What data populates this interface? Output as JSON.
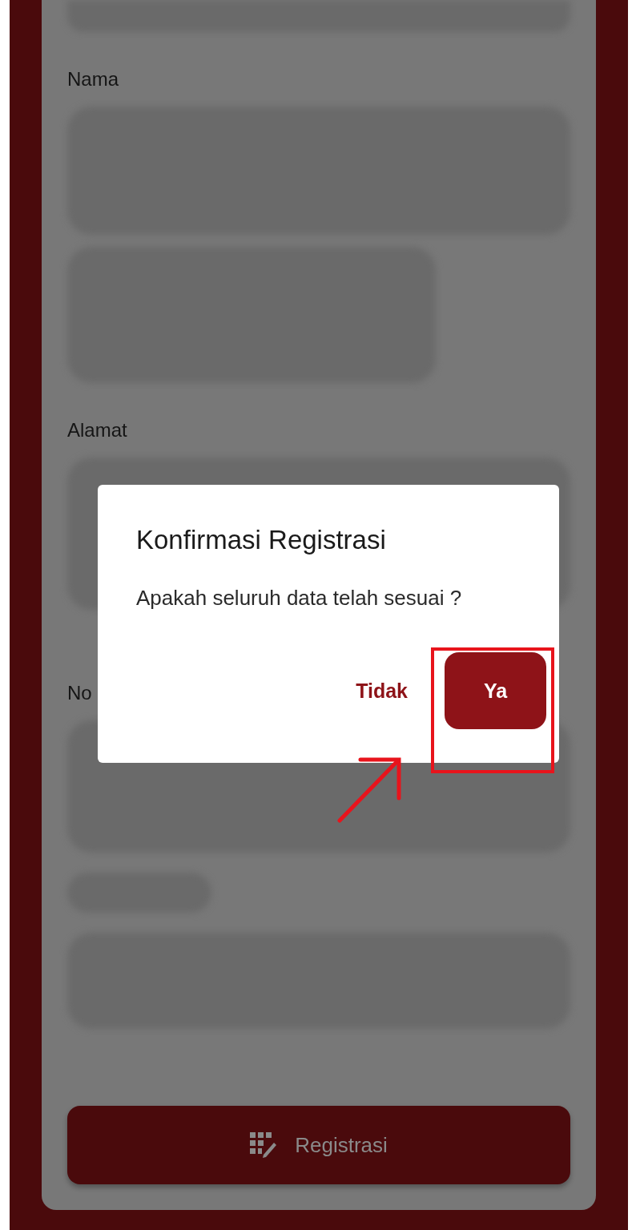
{
  "form": {
    "fields": [
      {
        "label": "Nama"
      },
      {
        "label": "Alamat"
      },
      {
        "label": "No"
      }
    ],
    "submit_button": {
      "label": "Registrasi"
    }
  },
  "dialog": {
    "title": "Konfirmasi Registrasi",
    "message": "Apakah seluruh data telah sesuai ?",
    "buttons": [
      {
        "label": "Tidak",
        "kind": "text"
      },
      {
        "label": "Ya",
        "kind": "filled"
      }
    ]
  }
}
